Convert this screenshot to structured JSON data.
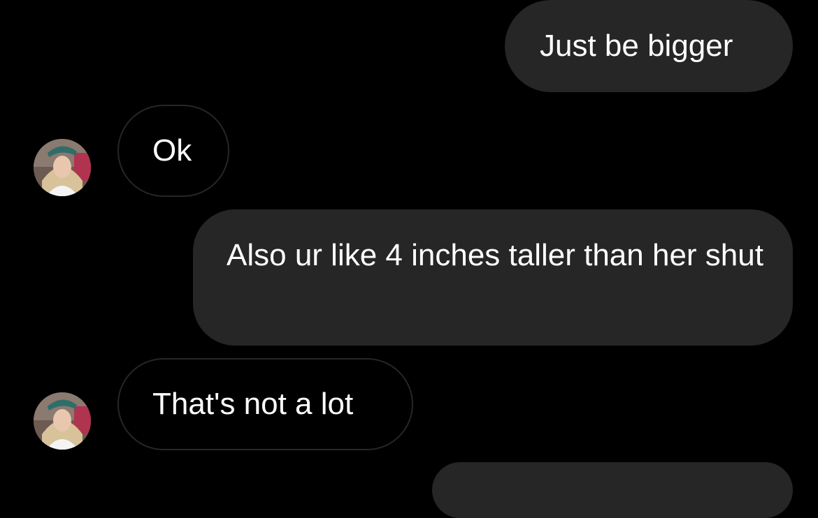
{
  "conversation": {
    "messages": [
      {
        "direction": "outgoing",
        "text": "Just be bigger"
      },
      {
        "direction": "incoming",
        "text": "Ok",
        "avatar": "contact-avatar"
      },
      {
        "direction": "outgoing",
        "text": "Also ur like 4 inches taller than her shut"
      },
      {
        "direction": "incoming",
        "text": "That's not a lot",
        "avatar": "contact-avatar"
      }
    ]
  },
  "colors": {
    "background": "#000000",
    "outgoing_bubble": "#262626",
    "incoming_bubble_border": "#262626",
    "text": "#ffffff"
  }
}
